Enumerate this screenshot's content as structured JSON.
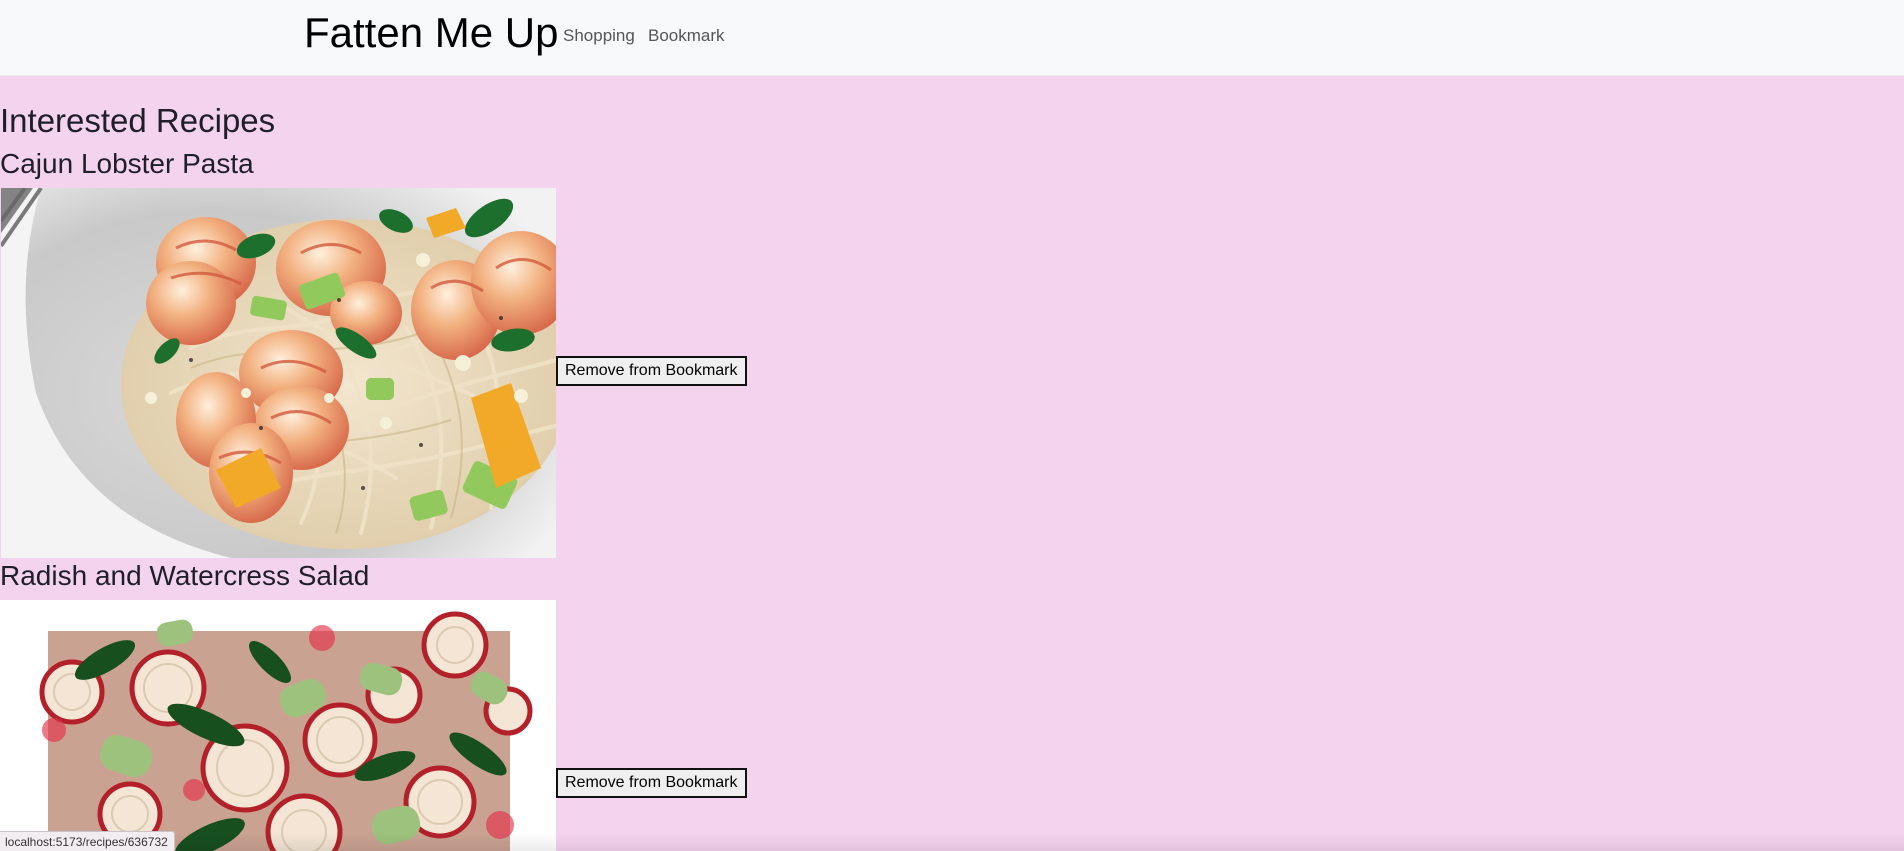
{
  "navbar": {
    "brand": "Fatten Me Up",
    "links": [
      {
        "label": "Shopping"
      },
      {
        "label": "Bookmark"
      }
    ]
  },
  "main": {
    "title": "Interested Recipes",
    "recipes": [
      {
        "title": "Cajun Lobster Pasta",
        "button_label": "Remove from Bookmark"
      },
      {
        "title": "Radish and Watercress Salad",
        "button_label": "Remove from Bookmark"
      }
    ]
  },
  "status_bar": {
    "url": "localhost:5173/recipes/636732"
  },
  "colors": {
    "page_background": "#f4d3ef",
    "navbar_background": "#f8f9fb",
    "button_background": "#efefef"
  }
}
